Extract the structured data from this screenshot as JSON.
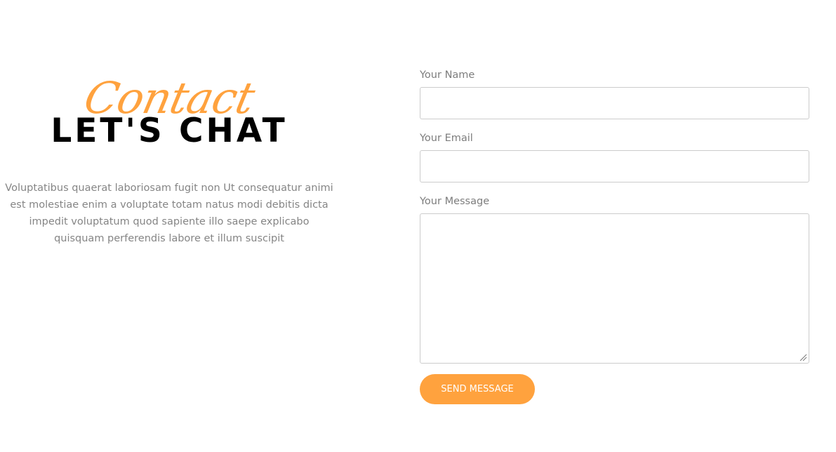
{
  "section": {
    "script_title": "Contact",
    "title": "LET'S CHAT",
    "description": "Voluptatibus quaerat laboriosam fugit non Ut consequatur animi est molestiae enim a voluptate totam natus modi debitis dicta impedit voluptatum quod sapiente illo saepe explicabo quisquam perferendis labore et illum suscipit"
  },
  "form": {
    "name_label": "Your Name",
    "name_value": "",
    "email_label": "Your Email",
    "email_value": "",
    "message_label": "Your Message",
    "message_value": "",
    "submit_label": "SEND MESSAGE"
  },
  "colors": {
    "accent": "#ffa23e",
    "heading": "#000000",
    "body_text": "#858585",
    "label_text": "#7d7d7d",
    "border": "#cccccc"
  }
}
